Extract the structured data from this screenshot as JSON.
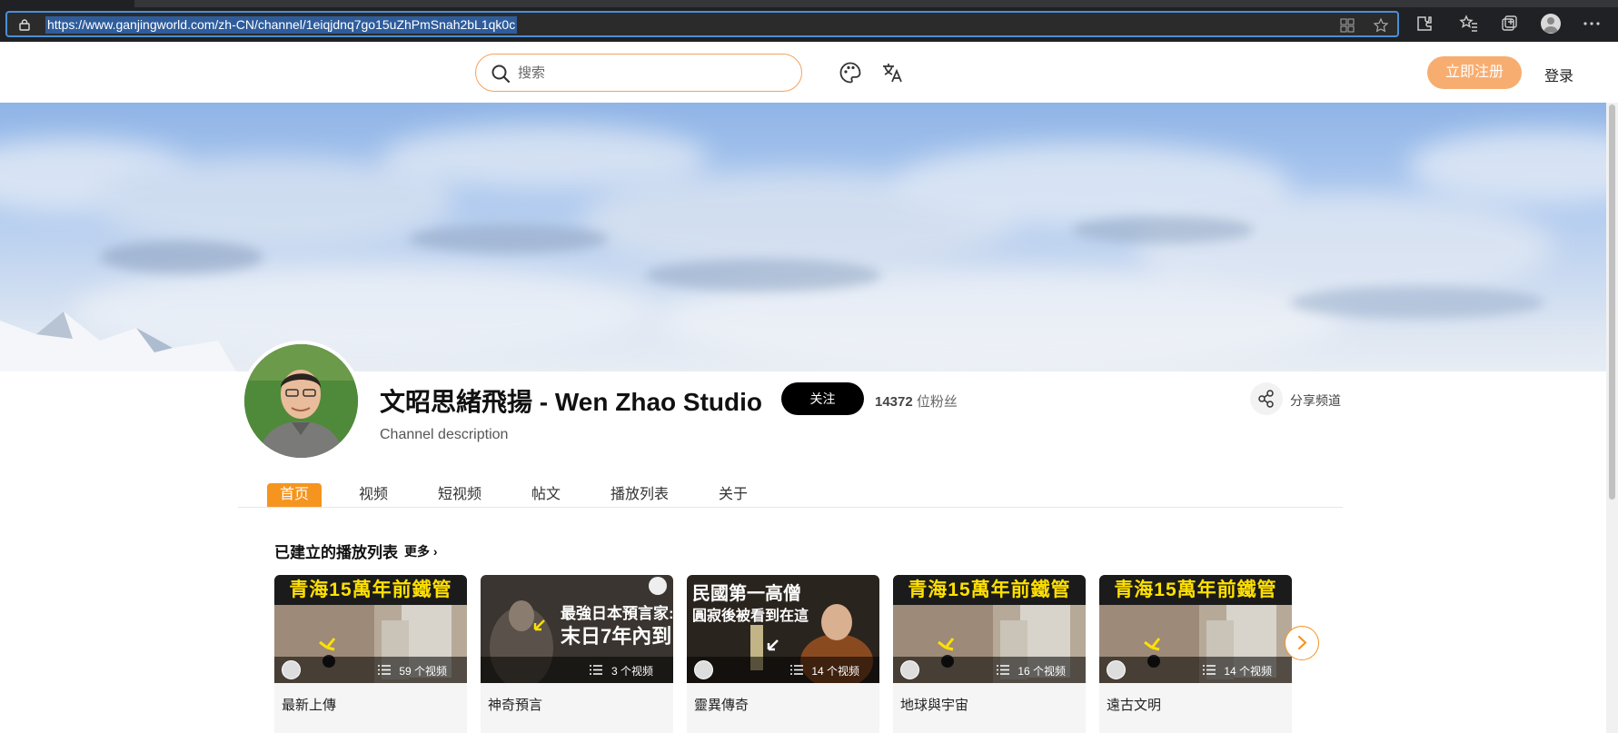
{
  "browser": {
    "url": "https://www.ganjingworld.com/zh-CN/channel/1eiqjdnq7go15uZhPmSnah2bL1qk0c"
  },
  "header": {
    "search_placeholder": "搜索",
    "register_label": "立即注册",
    "login_label": "登录"
  },
  "channel": {
    "title": "文昭思緒飛揚 - Wen Zhao Studio",
    "follow_label": "关注",
    "fans_count": "14372",
    "fans_suffix": "位粉丝",
    "description": "Channel description",
    "share_label": "分享频道"
  },
  "tabs": [
    "首页",
    "视频",
    "短视频",
    "帖文",
    "播放列表",
    "关于"
  ],
  "section": {
    "title": "已建立的播放列表",
    "more_label": "更多"
  },
  "playlists": [
    {
      "title": "最新上傳",
      "count": "59 个视频",
      "banner": "青海15萬年前鐵管"
    },
    {
      "title": "神奇預言",
      "count": "3 个视频",
      "banner_line1": "最強日本預言家:",
      "banner_line2": "末日7年內到"
    },
    {
      "title": "靈異傳奇",
      "count": "14 个视频",
      "banner_line1": "民國第一高僧",
      "banner_line2": "圓寂後被看到在這"
    },
    {
      "title": "地球與宇宙",
      "count": "16 个视频",
      "banner": "青海15萬年前鐵管"
    },
    {
      "title": "遠古文明",
      "count": "14 个视频",
      "banner": "青海15萬年前鐵管"
    }
  ],
  "colors": {
    "accent": "#f5941e",
    "register_bg": "#f8ad70",
    "search_border": "#f5a25d"
  }
}
